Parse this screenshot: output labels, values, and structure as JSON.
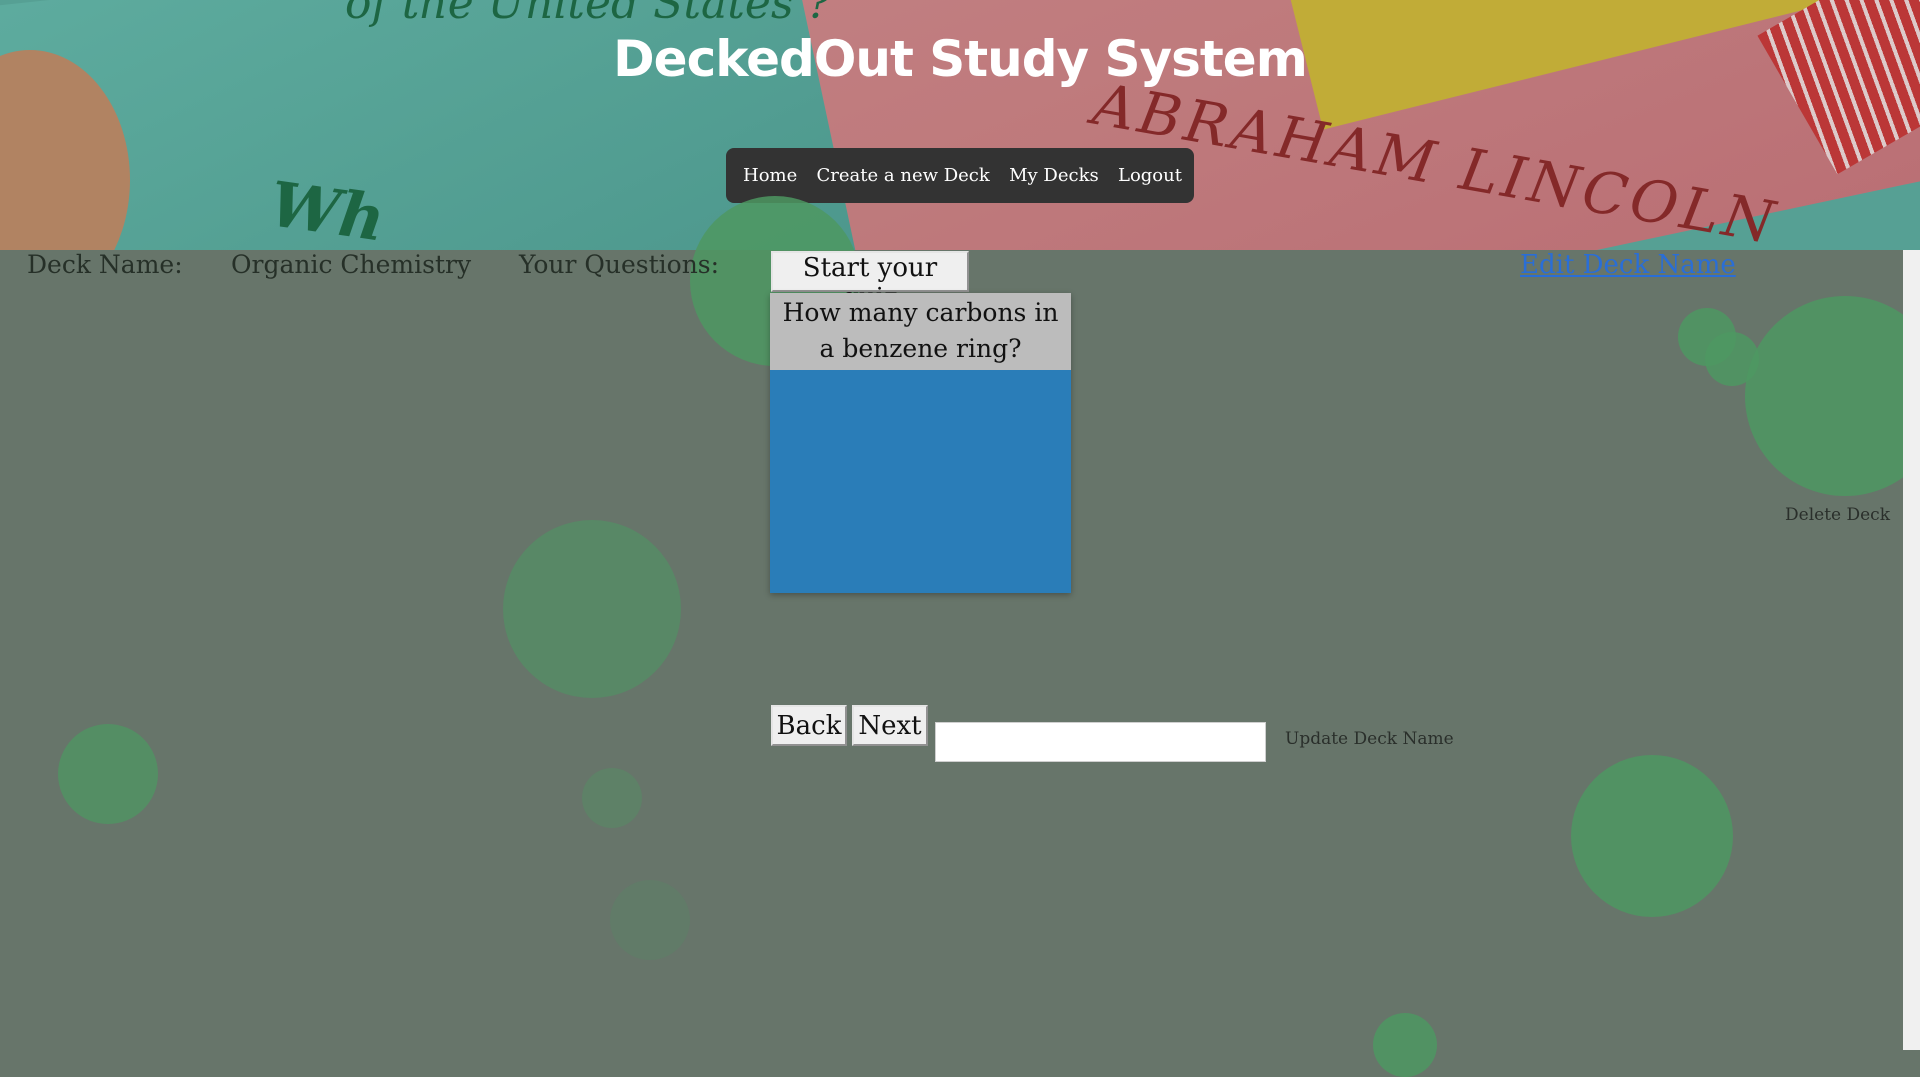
{
  "header": {
    "title": "DeckedOut Study System",
    "banner_text": {
      "top_scribble": "of the United States ?",
      "low_scribble": "Wh",
      "name_scribble": "ABRAHAM LINCOLN"
    }
  },
  "nav": {
    "items": [
      {
        "label": "Home"
      },
      {
        "label": "Create a new Deck"
      },
      {
        "label": "My Decks"
      },
      {
        "label": "Logout"
      }
    ]
  },
  "deck": {
    "name_label": "Deck Name:",
    "name_value": "Organic Chemistry",
    "questions_label": "Your Questions:",
    "start_quiz_label": "Start your quiz",
    "edit_deck_name_label": "Edit Deck Name",
    "delete_deck_label": "Delete Deck"
  },
  "flashcard": {
    "question": "How many carbons in a benzene ring?",
    "answer": ""
  },
  "controls": {
    "back_label": "Back",
    "next_label": "Next",
    "deck_name_input_value": "",
    "update_deck_name_label": "Update Deck Name"
  },
  "colors": {
    "page_background": "#67756a",
    "nav_background": "#333333",
    "card_question_bg": "#bcbcbc",
    "card_answer_bg": "#2a7db8",
    "link": "#2a6ed6",
    "bubble": "#4d9862"
  }
}
